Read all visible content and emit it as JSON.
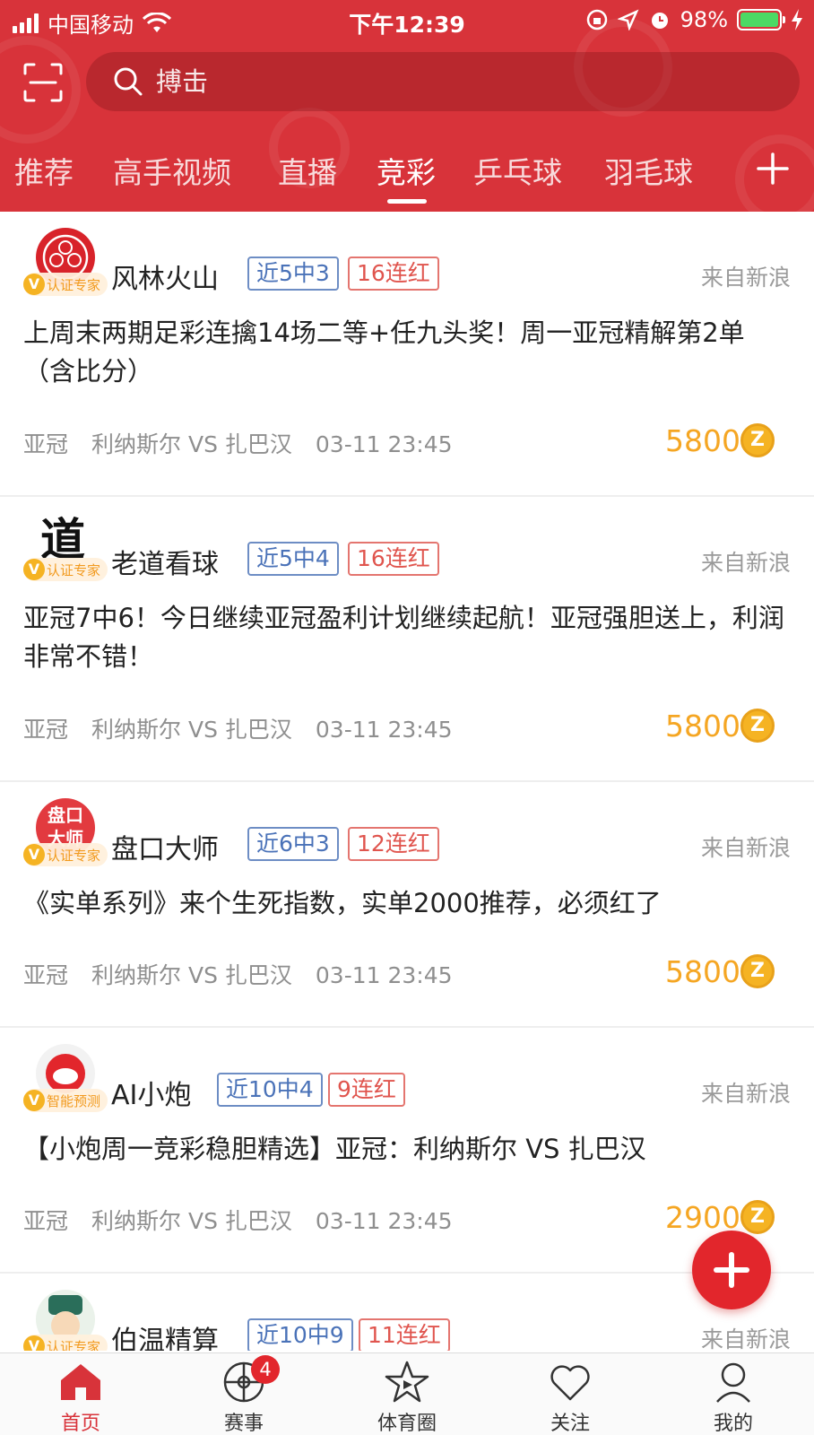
{
  "status_bar": {
    "carrier": "中国移动",
    "time": "下午12:39",
    "battery": "98%"
  },
  "search": {
    "placeholder": "搏击"
  },
  "tabs": [
    {
      "label": "推荐"
    },
    {
      "label": "高手视频"
    },
    {
      "label": "直播"
    },
    {
      "label": "竞彩",
      "active": true
    },
    {
      "label": "乒乓球"
    },
    {
      "label": "羽毛球"
    }
  ],
  "colors": {
    "brand_red": "#d8333a",
    "gold": "#f5a623",
    "tag_blue": "#4a72b8",
    "tag_red": "#e0554e"
  },
  "feed": [
    {
      "author": "风林火山",
      "badge": "认证专家",
      "record": "近5中3",
      "streak": "16连红",
      "source": "来自新浪",
      "title": "上周末两期足彩连擒14场二等+任九头奖！周一亚冠精解第2单（含比分）",
      "league": "亚冠",
      "match": "利纳斯尔 VS 扎巴汉",
      "time": "03-11 23:45",
      "price": "5800",
      "coin": "Z"
    },
    {
      "author": "老道看球",
      "badge": "认证专家",
      "record": "近5中4",
      "streak": "16连红",
      "source": "来自新浪",
      "title": "亚冠7中6！今日继续亚冠盈利计划继续起航！亚冠强胆送上，利润非常不错！",
      "league": "亚冠",
      "match": "利纳斯尔 VS 扎巴汉",
      "time": "03-11 23:45",
      "price": "5800",
      "coin": "Z",
      "avatar_text": "道"
    },
    {
      "author": "盘口大师",
      "badge": "认证专家",
      "record": "近6中3",
      "streak": "12连红",
      "source": "来自新浪",
      "title": "《实单系列》来个生死指数，实单2000推荐，必须红了",
      "league": "亚冠",
      "match": "利纳斯尔 VS 扎巴汉",
      "time": "03-11 23:45",
      "price": "5800",
      "coin": "Z",
      "avatar_text": "盘口大师"
    },
    {
      "author": "AI小炮",
      "badge": "智能预测",
      "record": "近10中4",
      "streak": "9连红",
      "source": "来自新浪",
      "title": "【小炮周一竞彩稳胆精选】亚冠：利纳斯尔 VS 扎巴汉",
      "league": "亚冠",
      "match": "利纳斯尔 VS 扎巴汉",
      "time": "03-11 23:45",
      "price": "2900",
      "coin": "Z"
    },
    {
      "author": "伯温精算",
      "badge": "认证专家",
      "record": "近10中9",
      "streak": "11连红",
      "source": "来自新浪"
    }
  ],
  "bottom_nav": [
    {
      "label": "首页",
      "icon": "home-icon",
      "active": true
    },
    {
      "label": "赛事",
      "icon": "ball-icon",
      "badge": "4"
    },
    {
      "label": "体育圈",
      "icon": "star-icon"
    },
    {
      "label": "关注",
      "icon": "heart-icon"
    },
    {
      "label": "我的",
      "icon": "person-icon"
    }
  ]
}
